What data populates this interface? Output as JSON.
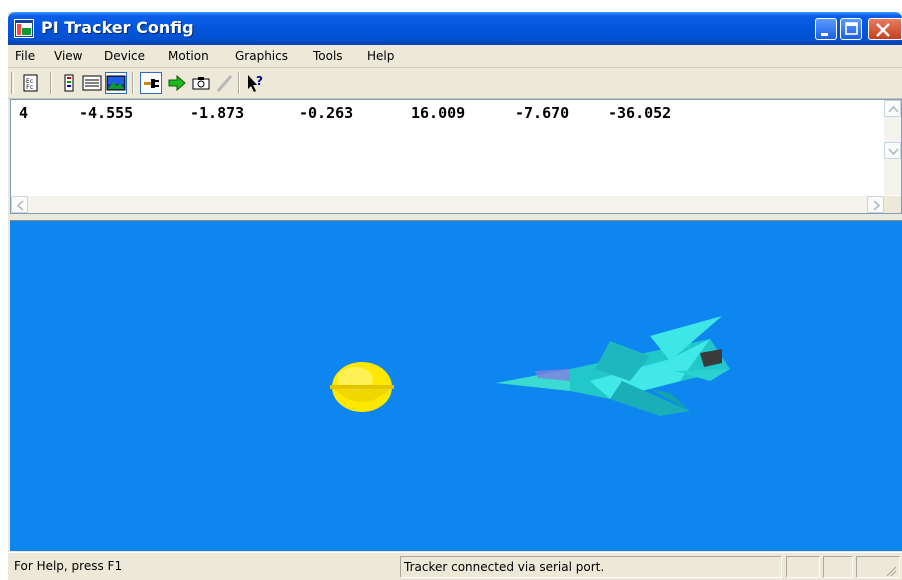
{
  "window": {
    "title": "PI Tracker Config"
  },
  "titlebar_buttons": [
    {
      "name": "minimize-icon"
    },
    {
      "name": "maximize-icon"
    },
    {
      "name": "close-icon"
    }
  ],
  "menu": {
    "items": [
      "File",
      "View",
      "Device",
      "Motion",
      "Graphics",
      "Tools",
      "Help"
    ]
  },
  "toolbar": {
    "icons": [
      "station-info-icon",
      "list-view-icon",
      "text-view-icon",
      "graphics-view-icon",
      "connect-plug-icon",
      "run-arrow-icon",
      "capture-camera-icon",
      "pen-icon",
      "context-help-icon"
    ]
  },
  "data": {
    "row": [
      "4",
      "-4.555",
      "-1.873",
      "-0.263",
      "16.009",
      "-7.670",
      "-36.052"
    ]
  },
  "scene": {
    "background_color": "#0d86f0",
    "objects": [
      "yellow-sphere-source",
      "cyan-jet-aircraft"
    ]
  },
  "status": {
    "help_text": "For Help, press F1",
    "connection_text": "Tracker connected via serial port."
  }
}
